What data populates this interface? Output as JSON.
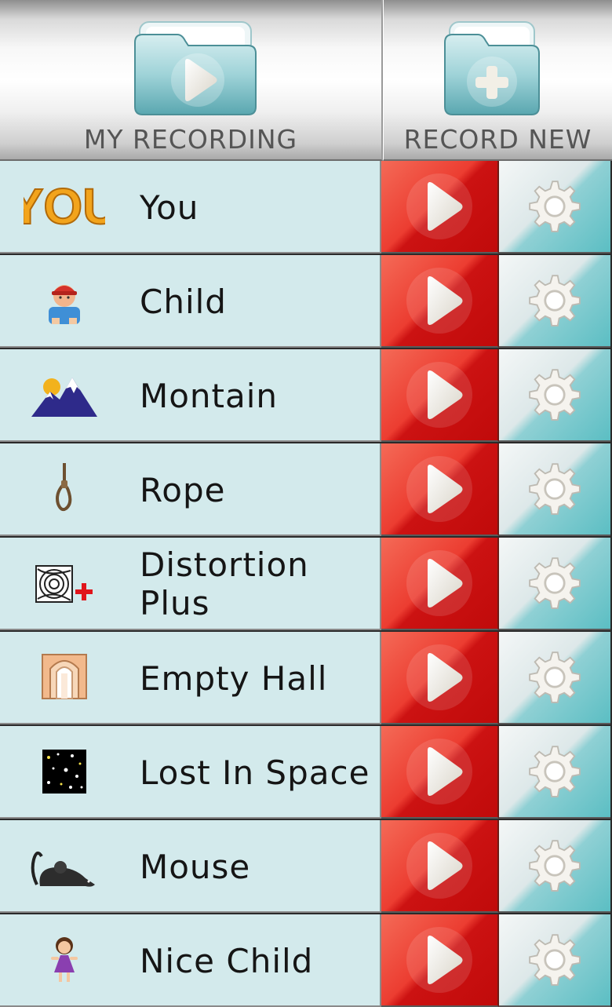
{
  "header": {
    "my_recording_label": "MY RECORDING",
    "record_new_label": "RECORD NEW"
  },
  "items": [
    {
      "label": "You",
      "icon": "you-text-icon",
      "icon_text": "YOU"
    },
    {
      "label": "Child",
      "icon": "child-icon"
    },
    {
      "label": "Montain",
      "icon": "mountain-icon"
    },
    {
      "label": "Rope",
      "icon": "rope-icon"
    },
    {
      "label": "Distortion Plus",
      "icon": "distortion-icon"
    },
    {
      "label": "Empty Hall",
      "icon": "hall-icon"
    },
    {
      "label": "Lost In Space",
      "icon": "space-icon"
    },
    {
      "label": "Mouse",
      "icon": "mouse-icon"
    },
    {
      "label": "Nice Child",
      "icon": "girl-icon"
    }
  ],
  "colors": {
    "row_bg": "#d3eaec",
    "play_red": "#e0231c",
    "gear_teal": "#5bbec3"
  }
}
